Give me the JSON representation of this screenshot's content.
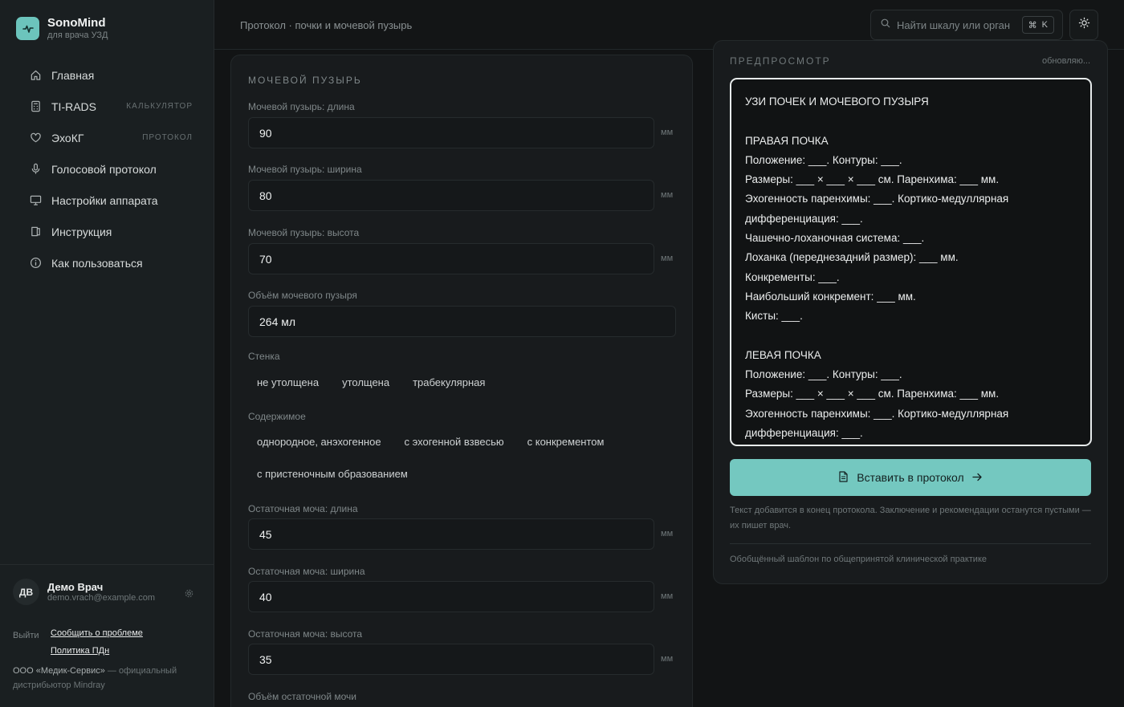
{
  "brand": {
    "name": "SonoMind",
    "subtitle": "для врача УЗД"
  },
  "nav": [
    {
      "icon": "home-icon",
      "label": "Главная",
      "tag": ""
    },
    {
      "icon": "calculator-icon",
      "label": "TI-RADS",
      "tag": "КАЛЬКУЛЯТОР"
    },
    {
      "icon": "heart-icon",
      "label": "ЭхоКГ",
      "tag": "ПРОТОКОЛ"
    },
    {
      "icon": "microphone-icon",
      "label": "Голосовой протокол",
      "tag": ""
    },
    {
      "icon": "monitor-icon",
      "label": "Настройки аппарата",
      "tag": ""
    },
    {
      "icon": "book-icon",
      "label": "Инструкция",
      "tag": ""
    },
    {
      "icon": "info-icon",
      "label": "Как пользоваться",
      "tag": ""
    }
  ],
  "user": {
    "initials": "ДВ",
    "name": "Демо Врач",
    "email": "demo.vrach@example.com"
  },
  "footer": {
    "logout": "Выйти",
    "report_link": "Сообщить о проблеме",
    "privacy_link": "Политика ПДн",
    "company_name": "ООО «Медик-Сервис»",
    "company_rest": " — официальный дистрибьютор Mindray"
  },
  "topbar": {
    "breadcrumb": "Протокол · почки и мочевой пузырь",
    "search_placeholder": "Найти шкалу или орган",
    "shortcut_key": "K"
  },
  "form": {
    "section_title": "МОЧЕВОЙ ПУЗЫРЬ",
    "bladder_length": {
      "label": "Мочевой пузырь: длина",
      "value": "90",
      "unit": "мм"
    },
    "bladder_width": {
      "label": "Мочевой пузырь: ширина",
      "value": "80",
      "unit": "мм"
    },
    "bladder_height": {
      "label": "Мочевой пузырь: высота",
      "value": "70",
      "unit": "мм"
    },
    "bladder_volume": {
      "label": "Объём мочевого пузыря",
      "value": "264 мл"
    },
    "wall": {
      "label": "Стенка",
      "options": [
        "не утолщена",
        "утолщена",
        "трабекулярная"
      ]
    },
    "content": {
      "label": "Содержимое",
      "options": [
        "однородное, анэхогенное",
        "с эхогенной взвесью",
        "с конкрементом",
        "с пристеночным образованием"
      ]
    },
    "residual_length": {
      "label": "Остаточная моча: длина",
      "value": "45",
      "unit": "мм"
    },
    "residual_width": {
      "label": "Остаточная моча: ширина",
      "value": "40",
      "unit": "мм"
    },
    "residual_height": {
      "label": "Остаточная моча: высота",
      "value": "35",
      "unit": "мм"
    },
    "residual_volume": {
      "label": "Объём остаточной мочи"
    }
  },
  "preview": {
    "title": "ПРЕДПРОСМОТР",
    "status": "обновляю...",
    "lines": [
      "УЗИ ПОЧЕК И МОЧЕВОГО ПУЗЫРЯ",
      "",
      "ПРАВАЯ ПОЧКА",
      "Положение: ___. Контуры: ___.",
      "Размеры: ___ × ___ × ___ см. Паренхима: ___ мм.",
      "Эхогенность паренхимы: ___. Кортико-медуллярная",
      "дифференциация: ___.",
      "Чашечно-лоханочная система: ___.",
      "Лоханка (переднезадний размер): ___ мм.",
      "Конкременты: ___.",
      "Наибольший конкремент: ___ мм.",
      "Кисты: ___.",
      "",
      "ЛЕВАЯ ПОЧКА",
      "Положение: ___. Контуры: ___.",
      "Размеры: ___ × ___ × ___ см. Паренхима: ___ мм.",
      "Эхогенность паренхимы: ___. Кортико-медуллярная",
      "дифференциация: ___."
    ],
    "insert_button": "Вставить в протокол",
    "note": "Текст добавится в конец протокола. Заключение и рекомендации останутся пустыми — их пишет врач.",
    "footer": "Обобщённый шаблон по общепринятой клинической практике"
  },
  "colors": {
    "accent": "#74c8c0",
    "background": "#121415",
    "panel": "#181b1d"
  }
}
